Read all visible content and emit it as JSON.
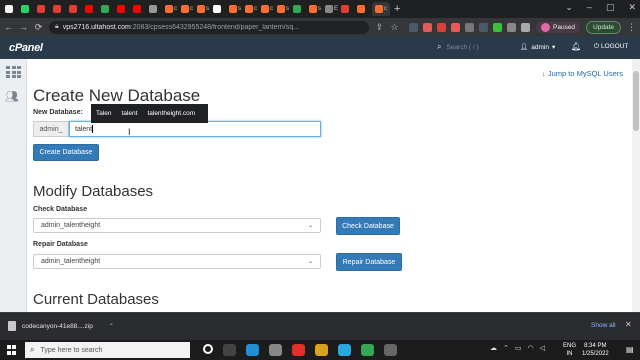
{
  "browser": {
    "tabs": [
      {
        "label": "",
        "color": "#f2f2f2"
      },
      {
        "label": "",
        "color": "#25d366"
      },
      {
        "label": "",
        "color": "#e43d30"
      },
      {
        "label": "",
        "color": "#e43d30"
      },
      {
        "label": "",
        "color": "#e43d30"
      },
      {
        "label": "",
        "color": "#ff0000"
      },
      {
        "label": "",
        "color": "#34a853"
      },
      {
        "label": "",
        "color": "#ff0000"
      },
      {
        "label": "",
        "color": "#ff0000"
      },
      {
        "label": "",
        "color": "#999999"
      },
      {
        "label": "c",
        "color": "#ff6c2c"
      },
      {
        "label": "c",
        "color": "#ff6c2c"
      },
      {
        "label": "s",
        "color": "#ff6c2c"
      },
      {
        "label": "",
        "color": "#ffffff"
      },
      {
        "label": "s",
        "color": "#ff6c2c"
      },
      {
        "label": "c",
        "color": "#ff6c2c"
      },
      {
        "label": "c",
        "color": "#ff6c2c"
      },
      {
        "label": "s",
        "color": "#ff6c2c"
      },
      {
        "label": "",
        "color": "#34a853"
      },
      {
        "label": "s",
        "color": "#ff6c2c"
      },
      {
        "label": "E",
        "color": "#888888"
      },
      {
        "label": "",
        "color": "#e43d30"
      },
      {
        "label": "",
        "color": "#ff6c2c"
      },
      {
        "label": "c",
        "color": "#ff6c2c",
        "active": true
      }
    ],
    "new_tab": "+",
    "url_host": "vps2716.ultahost.com",
    "url_rest": ":2083/cpsess6432955248/frontend/paper_lantern/sq...",
    "profile_label": "Paused",
    "update_label": "Update"
  },
  "header": {
    "logo": "cPanel",
    "search_placeholder": "Search ( / )",
    "user": "admin",
    "logout": "LOGOUT"
  },
  "main": {
    "jump_link": "Jump to MySQL Users",
    "create_title": "Create New Database",
    "new_db_label": "New Database:",
    "prefix": "admin_",
    "new_db_value": "talent",
    "create_button": "Create Database",
    "autocomplete": [
      "Talen",
      "talent",
      "talentheight.com"
    ],
    "modify_title": "Modify Databases",
    "check_label": "Check Database",
    "check_value": "admin_talentheight",
    "check_button": "Check Database",
    "repair_label": "Repair Database",
    "repair_value": "admin_talentheight",
    "repair_button": "Repair Database",
    "current_title": "Current Databases"
  },
  "downloads": {
    "file": "codecanyon-41e88....zip",
    "show_all": "Show all"
  },
  "taskbar": {
    "search_placeholder": "Type here to search",
    "lang_line1": "ENG",
    "lang_line2": "IN",
    "time": "8:34 PM",
    "date": "1/25/2022"
  }
}
